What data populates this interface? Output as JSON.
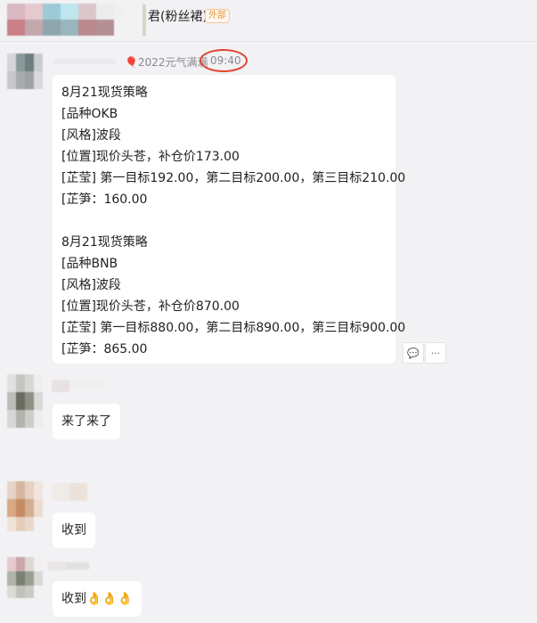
{
  "header": {
    "group_name": "君(粉丝裙)",
    "badge": "外部"
  },
  "messages": [
    {
      "sender_title": "🎈2022元气满满",
      "time": "09:40",
      "lines": [
        "8月21现货策略",
        "[品种OKB",
        "[风格]波段",
        "[位置]现价头苍，补仓价173.00",
        "[芷莹] 第一目标192.00，第二目标200.00，第三目标210.00",
        "[芷笋：160.00",
        "",
        "8月21现货策略",
        "[品种BNB",
        "[风格]波段",
        "[位置]现价头苍，补仓价870.00",
        "[芷莹] 第一目标880.00，第二目标890.00，第三目标900.00",
        "[芷笋：865.00"
      ]
    },
    {
      "text": "来了来了"
    },
    {
      "text": "收到"
    },
    {
      "text": "收到👌👌👌"
    }
  ],
  "actions": {
    "comment_icon": "💬",
    "more_icon": "···"
  },
  "colors": {
    "background": "#f2f2f4",
    "bubble": "#ffffff",
    "badge": "#e79a3e",
    "highlight_circle": "#e0442f"
  }
}
